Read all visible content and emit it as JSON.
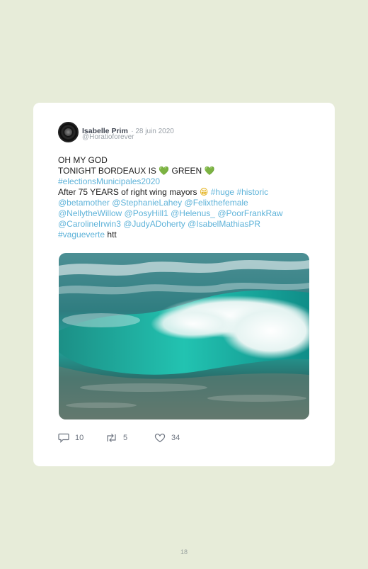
{
  "tweet": {
    "author_name": "Isabelle Prim",
    "date": "28 juin 2020",
    "handle": "@Horatioforever",
    "lines": {
      "l1": "OH MY GOD",
      "l2a": "TONIGHT BORDEAUX IS ",
      "l2b": "💚",
      "l2c": " GREEN ",
      "l2d": "💚",
      "l3": "#electionsMunicipales2020",
      "l4a": "After 75 YEARS of right wing mayors ",
      "l4b": "😁",
      "l4c": "#huge",
      "l4d": "#historic",
      "l5a": "@betamother",
      "l5b": "@StephanieLahey",
      "l5c": "@Felixthefemale",
      "l6a": "@NellytheWillow",
      "l6b": "@PosyHill1",
      "l6c": "@Helenus_",
      "l6d": "@PoorFrankRaw",
      "l7a": "@CarolineIrwin3",
      "l7b": "@JudyADoherty",
      "l7c": "@IsabelMathiasPR",
      "l8a": "#vagueverte",
      "l8b": "htt"
    },
    "actions": {
      "replies": "10",
      "retweets": "5",
      "likes": "34"
    },
    "colors": {
      "link": "#5fb3d9",
      "text": "#1d1d1d",
      "meta": "#9aa1a8"
    },
    "icons": {
      "reply": "speech-bubble-icon",
      "retweet": "retweet-icon",
      "like": "heart-icon"
    }
  },
  "page": {
    "number": "18",
    "background": "#e7ecd9"
  }
}
